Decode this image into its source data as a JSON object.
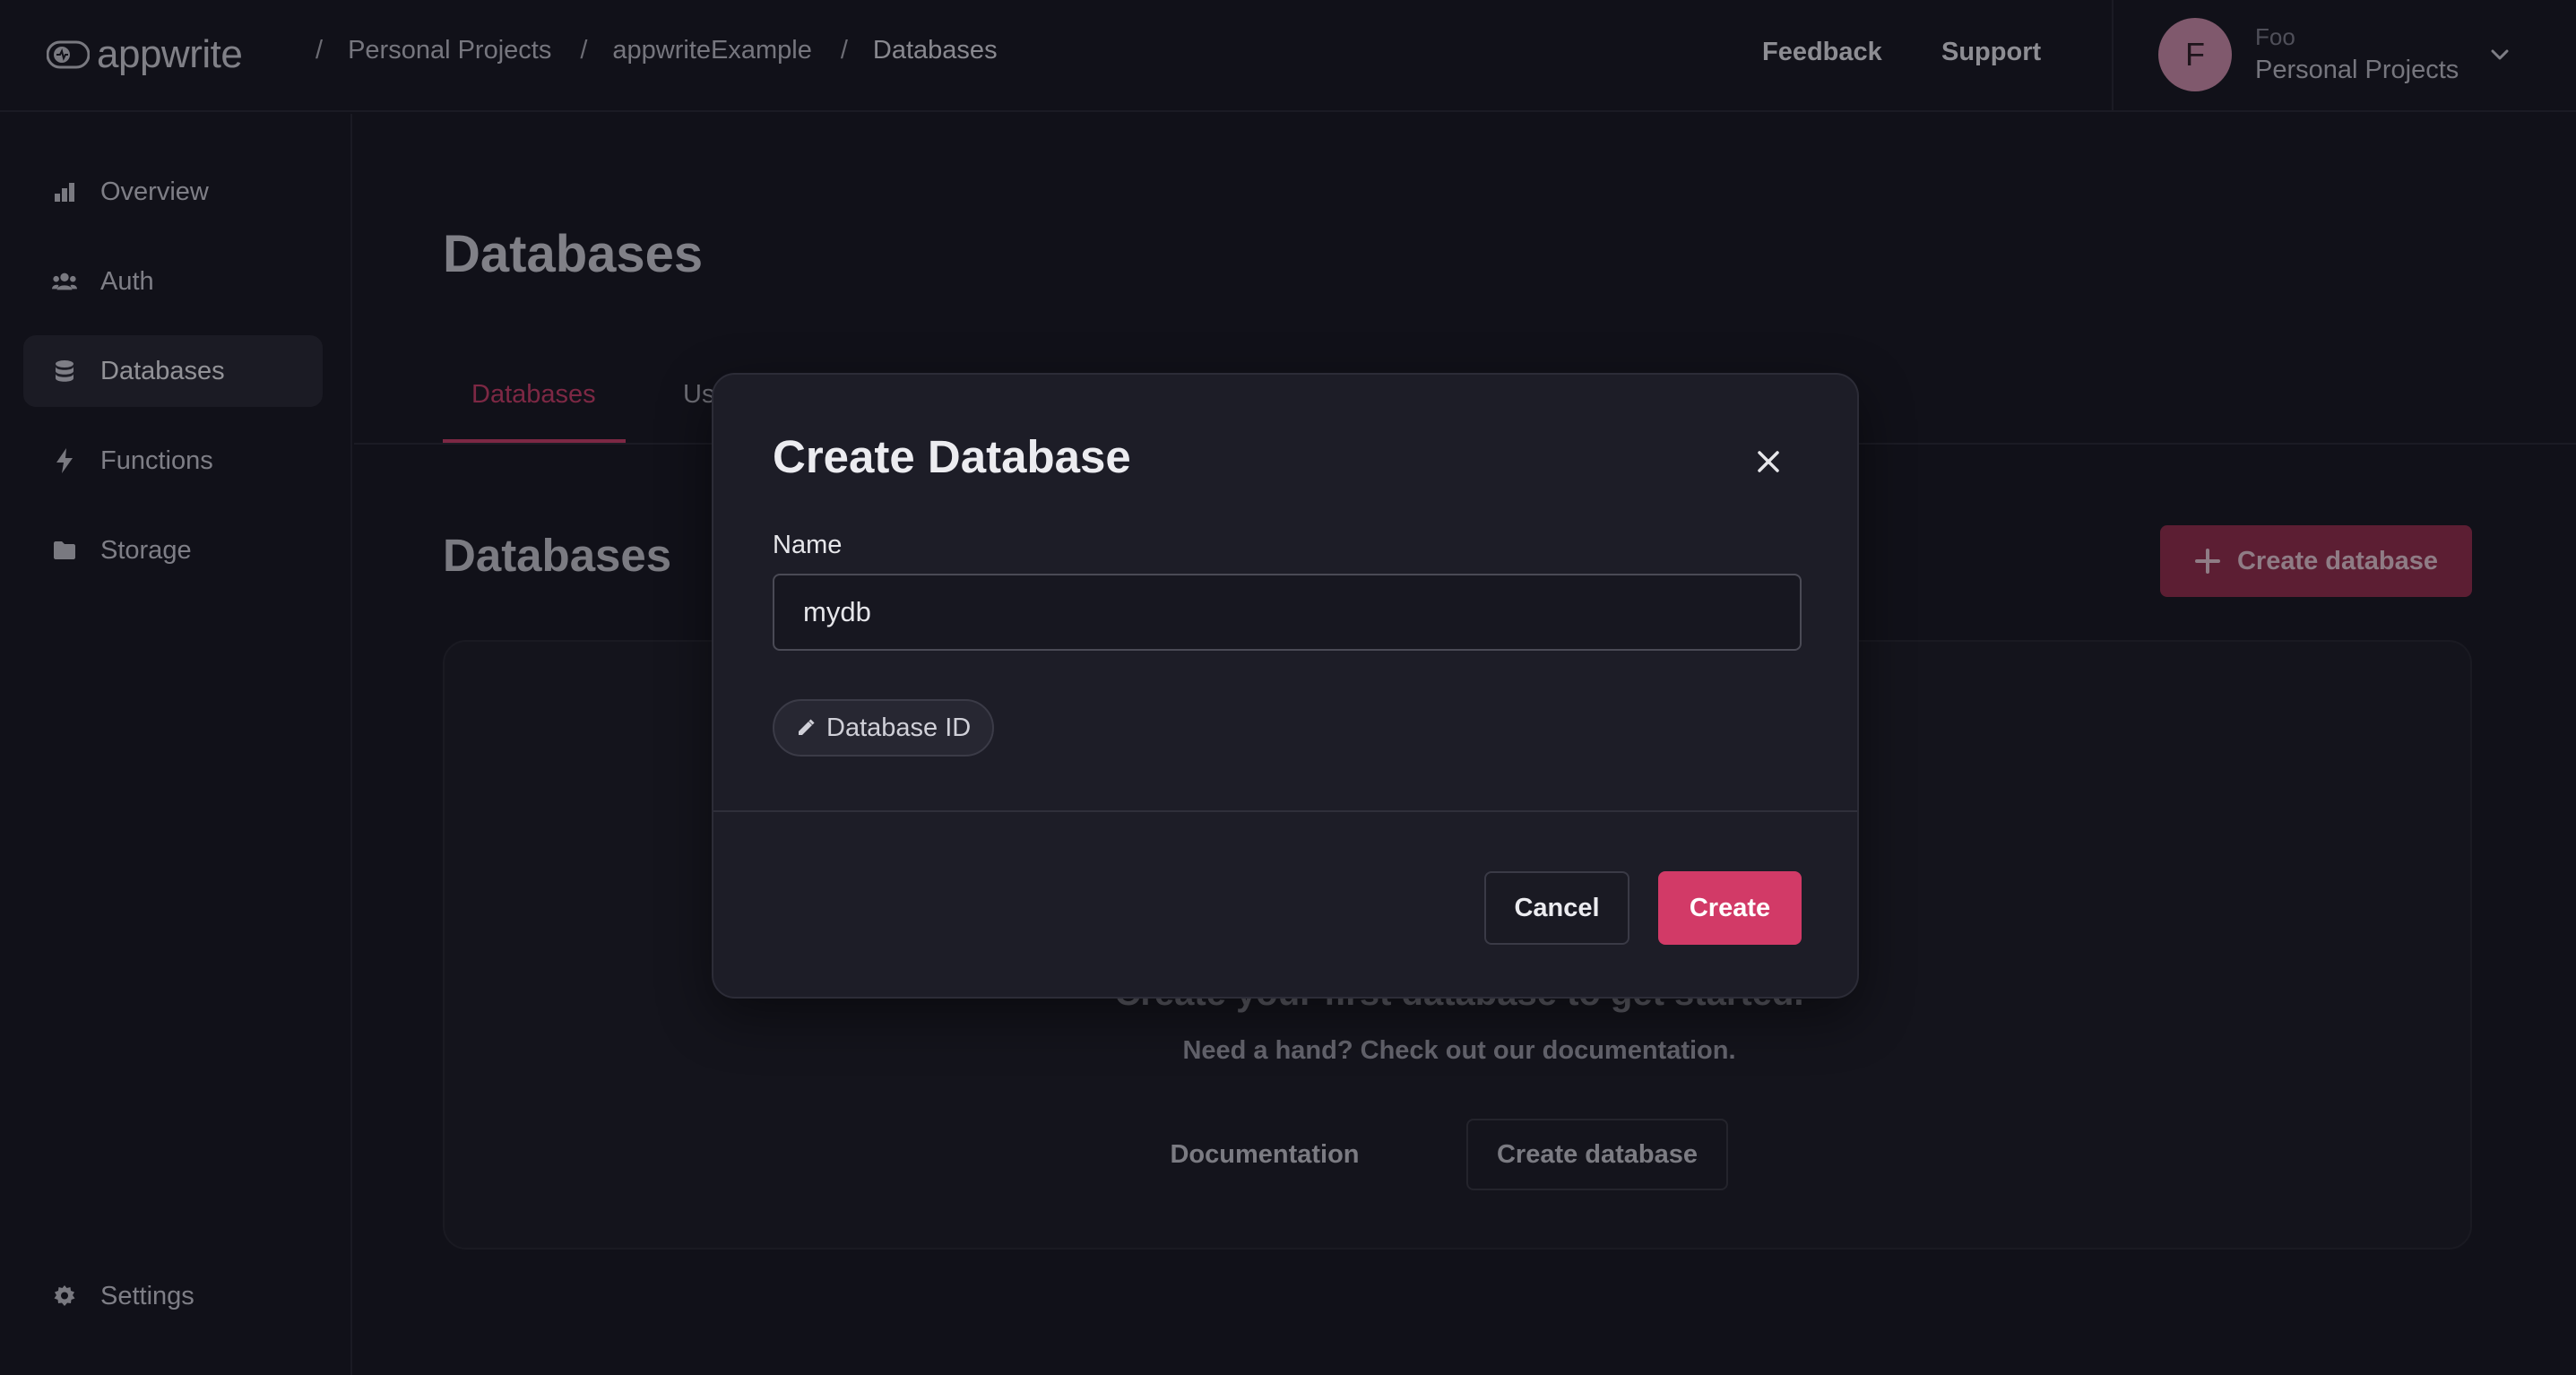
{
  "header": {
    "logo_text": "appwrite",
    "breadcrumb": [
      "Personal Projects",
      "appwriteExample",
      "Databases"
    ],
    "feedback_label": "Feedback",
    "support_label": "Support",
    "account": {
      "initial": "F",
      "name": "Foo",
      "org": "Personal Projects"
    }
  },
  "sidebar": {
    "items": [
      {
        "label": "Overview",
        "icon": "bar-chart-icon"
      },
      {
        "label": "Auth",
        "icon": "users-icon"
      },
      {
        "label": "Databases",
        "icon": "database-icon",
        "active": true
      },
      {
        "label": "Functions",
        "icon": "lightning-icon"
      },
      {
        "label": "Storage",
        "icon": "folder-icon"
      }
    ],
    "settings_label": "Settings"
  },
  "main": {
    "page_title": "Databases",
    "tabs": [
      {
        "label": "Databases",
        "active": true
      },
      {
        "label": "Us"
      }
    ],
    "section_title": "Databases",
    "create_button": "Create database",
    "empty_state": {
      "title": "Create your first database to get started.",
      "subtitle": "Need a hand? Check out our documentation.",
      "documentation_label": "Documentation",
      "create_label": "Create database"
    }
  },
  "modal": {
    "title": "Create Database",
    "name_label": "Name",
    "name_value": "mydb",
    "id_chip_label": "Database ID",
    "cancel_label": "Cancel",
    "create_label": "Create"
  },
  "colors": {
    "accent": "#d23a67",
    "background": "#16161f",
    "modal_bg": "#1d1d27"
  }
}
